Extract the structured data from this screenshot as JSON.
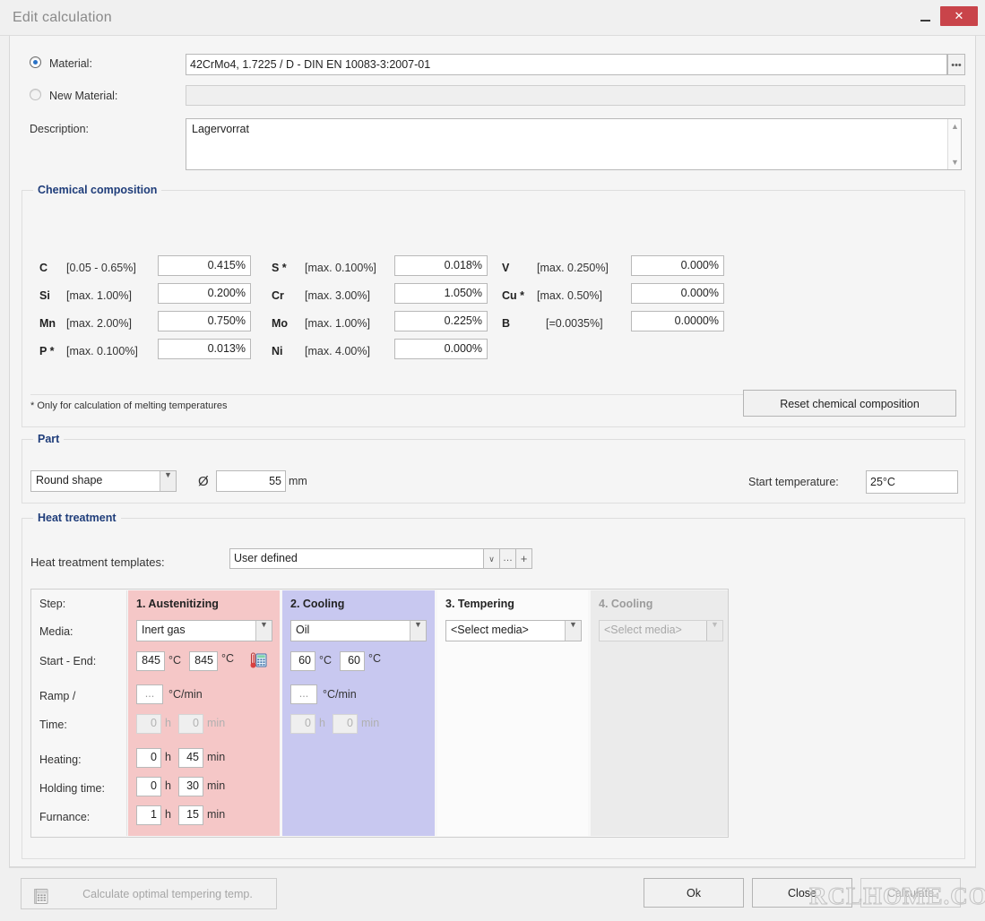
{
  "window": {
    "title": "Edit calculation",
    "minimize_label": "",
    "close_label": "✕"
  },
  "material": {
    "material_radio_label": "Material:",
    "material_value": "42CrMo4, 1.7225 / D - DIN EN 10083-3:2007-01",
    "material_browse_label": "•••",
    "new_material_radio_label": "New Material:",
    "new_material_value": "",
    "description_label": "Description:",
    "description_value": "Lagervorrat",
    "scroll_up_icon": "▲",
    "scroll_down_icon": "▼"
  },
  "chemical": {
    "title": "Chemical composition",
    "columns": [
      [
        {
          "symbol": "C",
          "range": "[0.05 - 0.65%]",
          "value": "0.415%"
        },
        {
          "symbol": "Si",
          "range": "[max. 1.00%]",
          "value": "0.200%"
        },
        {
          "symbol": "Mn",
          "range": "[max. 2.00%]",
          "value": "0.750%"
        },
        {
          "symbol": "P *",
          "range": "[max. 0.100%]",
          "value": "0.013%"
        }
      ],
      [
        {
          "symbol": "S *",
          "range": "[max. 0.100%]",
          "value": "0.018%"
        },
        {
          "symbol": "Cr",
          "range": "[max. 3.00%]",
          "value": "1.050%"
        },
        {
          "symbol": "Mo",
          "range": "[max. 1.00%]",
          "value": "0.225%"
        },
        {
          "symbol": "Ni",
          "range": "[max. 4.00%]",
          "value": "0.000%"
        }
      ],
      [
        {
          "symbol": "V",
          "range": "[max. 0.250%]",
          "value": "0.000%"
        },
        {
          "symbol": "Cu *",
          "range": "[max. 0.50%]",
          "value": "0.000%"
        },
        {
          "symbol": "B",
          "range": "[=0.0035%]",
          "value": "0.0000%"
        }
      ]
    ],
    "footnote": "* Only for calculation of melting temperatures",
    "reset_button": "Reset chemical composition"
  },
  "part": {
    "title": "Part",
    "shape_value": "Round shape",
    "diameter_symbol": "Ø",
    "diameter_value": "55",
    "diameter_unit": "mm",
    "start_temperature_label": "Start temperature:",
    "start_temperature_value": "25°C"
  },
  "heat_treatment": {
    "title": "Heat treatment",
    "templates_label": "Heat treatment templates:",
    "templates_value": "User defined",
    "templates_dropdown_icon": "∨",
    "templates_browse_icon": "…",
    "templates_add_icon": "+",
    "row_labels": [
      "Step:",
      "Media:",
      "Start - End:",
      "Ramp /",
      "Time:",
      "Heating:",
      "Holding time:",
      "Furnance:"
    ],
    "units": {
      "celsius": "°C",
      "ramp": "°C/min",
      "hour": "h",
      "minute": "min",
      "dots": "..."
    },
    "steps": [
      {
        "name": "1. Austenitizing",
        "media": "Inert gas",
        "start": "845",
        "end": "845",
        "ramp": "...",
        "time_h": "0",
        "time_min": "0",
        "heating_h": "0",
        "heating_min": "45",
        "holding_h": "0",
        "holding_min": "30",
        "furnance_h": "1",
        "furnance_min": "15",
        "enabled": true
      },
      {
        "name": "2. Cooling",
        "media": "Oil",
        "start": "60",
        "end": "60",
        "ramp": "...",
        "time_h": "0",
        "time_min": "0",
        "enabled": true
      },
      {
        "name": "3. Tempering",
        "media": "<Select media>",
        "enabled": true
      },
      {
        "name": "4. Cooling",
        "media": "<Select media>",
        "enabled": false
      }
    ]
  },
  "footer": {
    "calc_temper_button": "Calculate optimal tempering temp.",
    "ok_button": "Ok",
    "close_button": "Close",
    "calculate_button": "Calculate",
    "watermark": "RCLHOME.COM"
  }
}
